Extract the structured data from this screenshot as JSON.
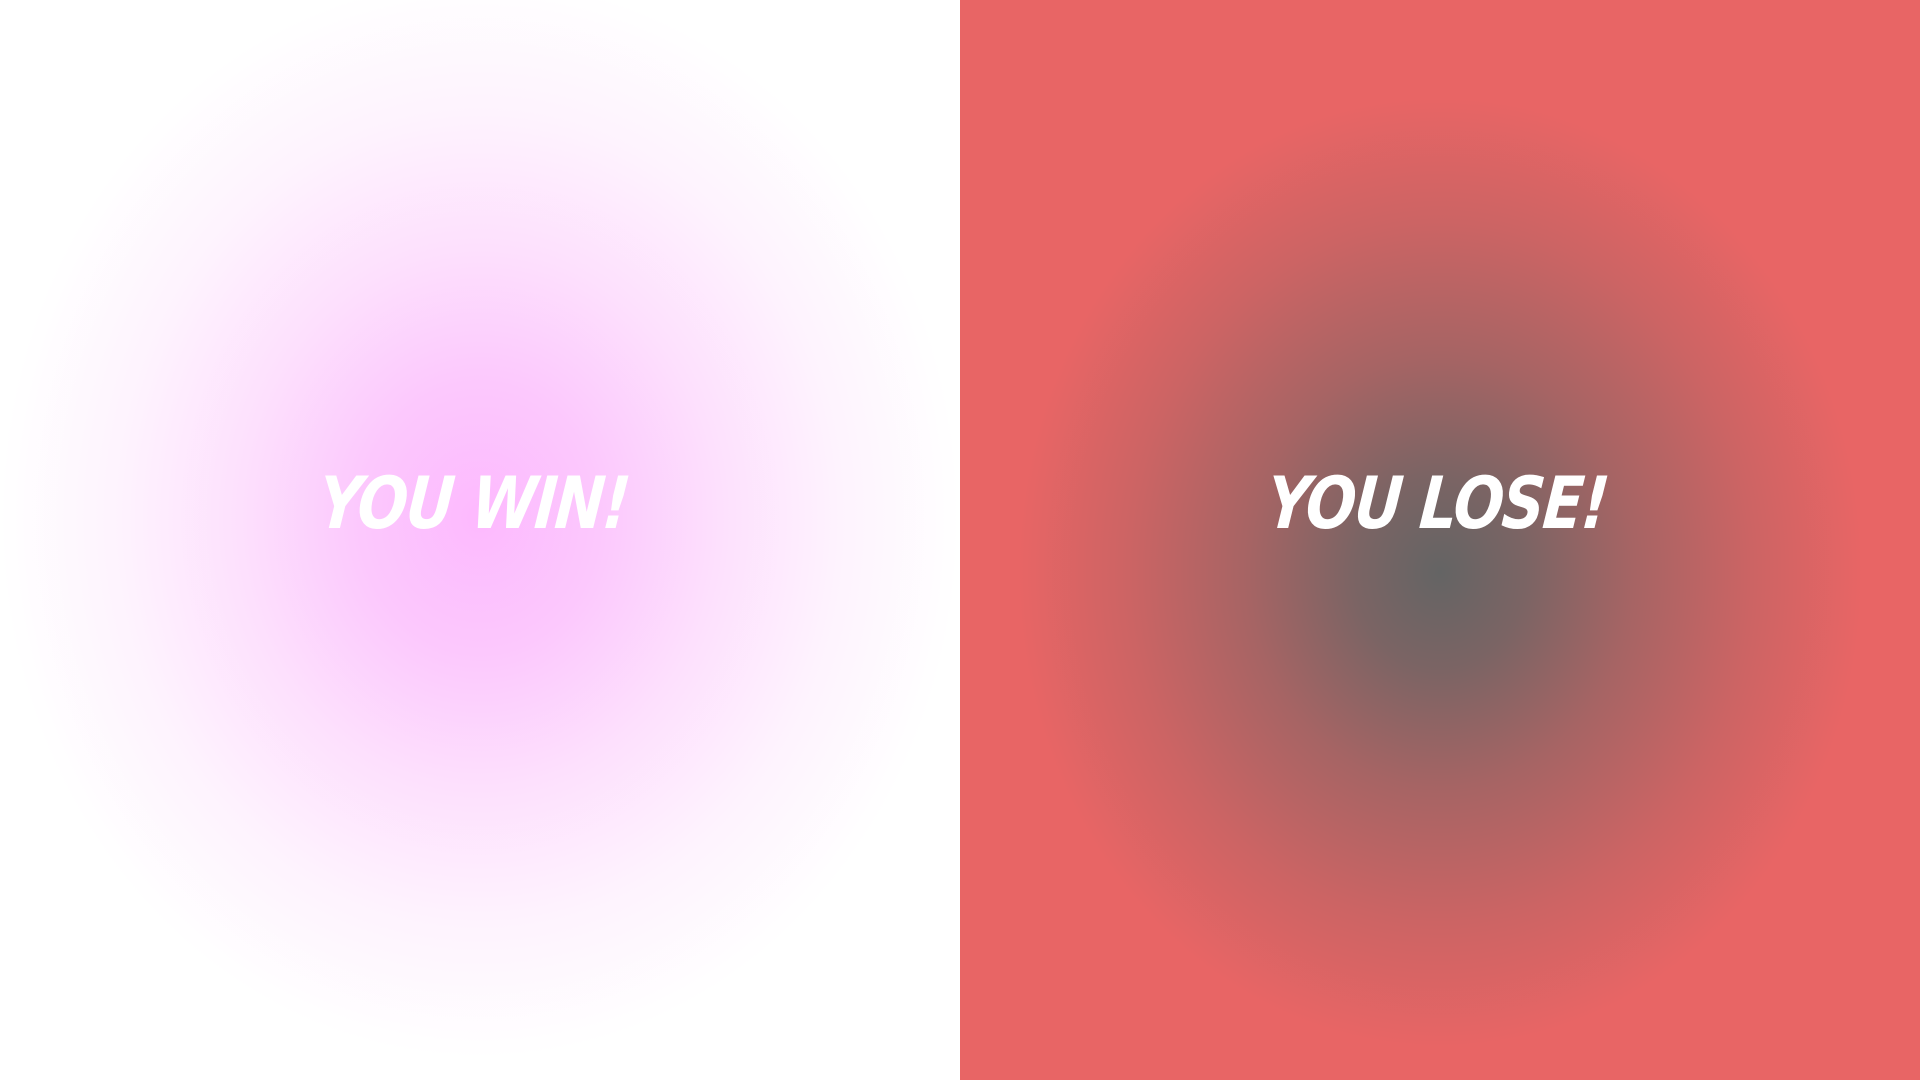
{
  "win_panel": {
    "label": "YOU WIN!",
    "accent_color": "#fdb9fe",
    "edge_color": "#ffffff"
  },
  "lose_panel": {
    "label": "YOU LOSE!",
    "accent_color": "#646464",
    "edge_color": "#e86565"
  }
}
